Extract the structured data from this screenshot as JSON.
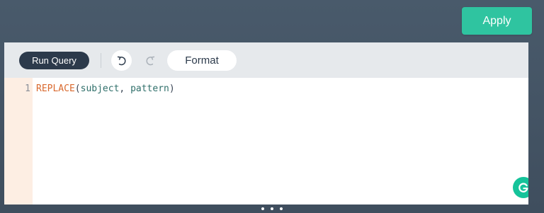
{
  "header": {
    "apply_label": "Apply"
  },
  "toolbar": {
    "run_query_label": "Run Query",
    "format_label": "Format",
    "undo_icon": "undo-icon",
    "redo_icon": "redo-icon"
  },
  "editor": {
    "lines": [
      {
        "number": "1",
        "tokens": {
          "function": "REPLACE",
          "open_paren": "(",
          "arg1": "subject",
          "comma": ", ",
          "arg2": "pattern",
          "close_paren": ")"
        }
      }
    ]
  },
  "icons": {
    "grammarly": "grammarly-icon",
    "resize": "drag-handle-icon"
  },
  "colors": {
    "accent": "#2fc4a0",
    "run_button": "#2c3a4b",
    "gutter": "#fdeee3",
    "keyword": "#d9692e",
    "argument": "#2f6f6a",
    "grammarly": "#15c39a"
  }
}
